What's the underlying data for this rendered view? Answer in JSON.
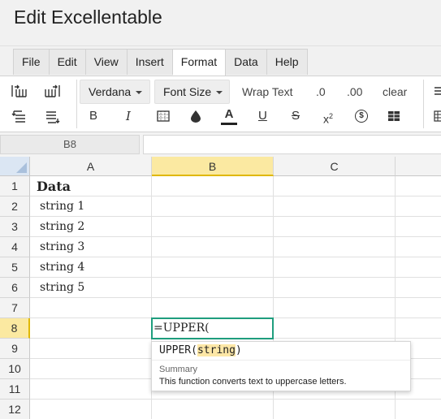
{
  "app": {
    "title": "Edit Excellentable"
  },
  "menu": {
    "items": [
      "File",
      "Edit",
      "View",
      "Insert",
      "Format",
      "Data",
      "Help"
    ],
    "active": "Format"
  },
  "toolbar": {
    "font_family": "Verdana",
    "font_size": "Font Size",
    "wrap_text": "Wrap Text",
    "decrease_decimals": ".0",
    "increase_decimals": ".00",
    "clear": "clear",
    "bold": "B",
    "italic": "I",
    "font_color_letter": "A",
    "underline": "U",
    "strikethrough": "S",
    "superscript_base": "x",
    "superscript_exp": "2",
    "currency_symbol": "$"
  },
  "formula_bar": {
    "cell_ref": "B8",
    "value": ""
  },
  "grid": {
    "columns": [
      "A",
      "B",
      "C"
    ],
    "selected_column": "B",
    "rows": [
      {
        "row": "1",
        "a": "Data"
      },
      {
        "row": "2",
        "a": "string 1"
      },
      {
        "row": "3",
        "a": "string 2"
      },
      {
        "row": "4",
        "a": "string 3"
      },
      {
        "row": "5",
        "a": "string 4"
      },
      {
        "row": "6",
        "a": "string 5"
      },
      {
        "row": "7",
        "a": ""
      },
      {
        "row": "8",
        "a": ""
      },
      {
        "row": "9",
        "a": ""
      },
      {
        "row": "10",
        "a": ""
      },
      {
        "row": "11",
        "a": ""
      },
      {
        "row": "12",
        "a": ""
      }
    ],
    "selected_row": "8"
  },
  "editor": {
    "value": "=UPPER("
  },
  "autocomplete": {
    "func": "UPPER",
    "open": "(",
    "arg": "string",
    "close": ")",
    "summary_label": "Summary",
    "summary": "This function converts text to uppercase letters."
  },
  "colors": {
    "accent": "#1f9e7e",
    "selection": "#fbe9a1",
    "arg_highlight": "#fde7a6"
  }
}
